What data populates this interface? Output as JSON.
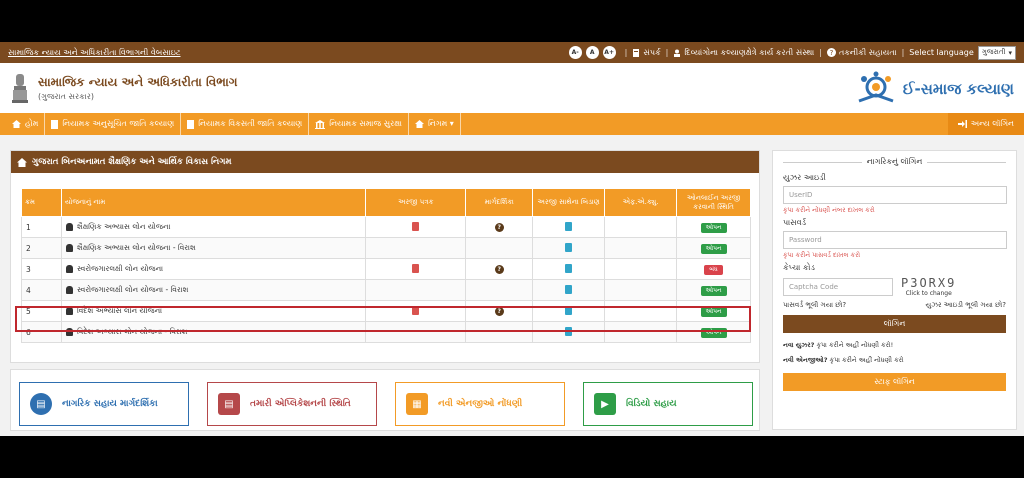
{
  "topbar": {
    "site_link": "સામાજિક ન્યાય અને અધિકારીતા વિભાગની વેબસાઇટ",
    "font_small": "A-",
    "font_normal": "A",
    "font_large": "A+",
    "contact": "સંપર્ક",
    "org_link": "દિવ્યાંગોના કલ્યાણક્ષેત્રે કાર્ય કરતી સંસ્થા",
    "tech_help": "તકનીકી સહાયતા",
    "select_language": "Select language",
    "language_value": "ગુજરાતી"
  },
  "header": {
    "dept_title": "સામાજિક ન્યાય અને અધિકારીતા વિભાગ",
    "dept_subtitle": "(ગુજરાત સરકાર)",
    "brand_name": "ઈ-સમાજ કલ્યાણ"
  },
  "nav": {
    "items": [
      "હોમ",
      "નિયામક અનુસૂચિત જાતિ કલ્યાણ",
      "નિયામક વિકસતી જાતિ કલ્યાણ",
      "નિયામક સમાજ સુરક્ષા",
      "નિગમ ▾"
    ],
    "login": "અન્ય લૉગિન"
  },
  "panel": {
    "title": "ગુજરાત બિનઅનામત શૈક્ષણિક અને આર્થિક વિકાસ નિગમ"
  },
  "table": {
    "headers": [
      "ક્રમ",
      "યોજનાનું નામ",
      "અરજી પત્રક",
      "માર્ગદર્શિકા",
      "અરજી સાથેના બિડાણ",
      "એફ.એ.ક્યુ.",
      "ઓનલાઈન અરજી કરવાની સ્થિતિ"
    ],
    "rows": [
      {
        "no": "1",
        "name": "શૈક્ષણિક અભ્યાસ લોન યોજના",
        "status": "ઓપન"
      },
      {
        "no": "2",
        "name": "શૈક્ષણિક અભ્યાસ લોન યોજના - વિરાશ",
        "status": "ઓપન"
      },
      {
        "no": "3",
        "name": "સ્વરોજગારલક્ષી લોન યોજના",
        "status": "બંધ"
      },
      {
        "no": "4",
        "name": "સ્વરોજગારલક્ષી લોન યોજના - વિરાશ",
        "status": "ઓપન"
      },
      {
        "no": "5",
        "name": "વિદેશ અભ્યાસ લોન યોજના",
        "status": "ઓપન"
      },
      {
        "no": "6",
        "name": "વિદેશ અભ્યાસ લોન યોજના - વિરાશ",
        "status": "ઓપન"
      }
    ]
  },
  "quick": {
    "b1": "નાગરિક સહાય માર્ગદર્શિકા",
    "b2": "તમારી એપ્લિકેશનની સ્થિતિ",
    "b3": "નવી એનજીઓ નોંધણી",
    "b4": "વિડિયો સહાય"
  },
  "login": {
    "title": "નાગરિકનું લૉગિન",
    "user_label": "યુઝર આઇડી",
    "user_placeholder": "UserID",
    "user_hint": "કૃપા કરીને નોંધણી નંબર દાખલ કરો",
    "pass_label": "પાસવર્ડ",
    "pass_placeholder": "Password",
    "pass_hint": "કૃપા કરીને પાસવર્ડ દાખલ કરો",
    "captcha_label": "કેપ્ચા કોડ",
    "captcha_placeholder": "Captcha Code",
    "captcha_text": "P3ORX9",
    "captcha_change": "Click to change",
    "forgot_pass": "પાસવર્ડ ભૂલી ગયા છો?",
    "forgot_user": "યુઝર આઇડી ભૂલી ગયા છો?",
    "login_btn": "લૉગિન",
    "new_user_bold": "નવા યુઝર?",
    "new_user_text": " કૃપા કરીને અહીં નોંધણી કરો!",
    "new_ngo_bold": "નવી એનજીઓ?",
    "new_ngo_text": " કૃપા કરીને અહીં નોંધણી કરો",
    "staff_login": "સ્ટાફ લૉગિન"
  }
}
